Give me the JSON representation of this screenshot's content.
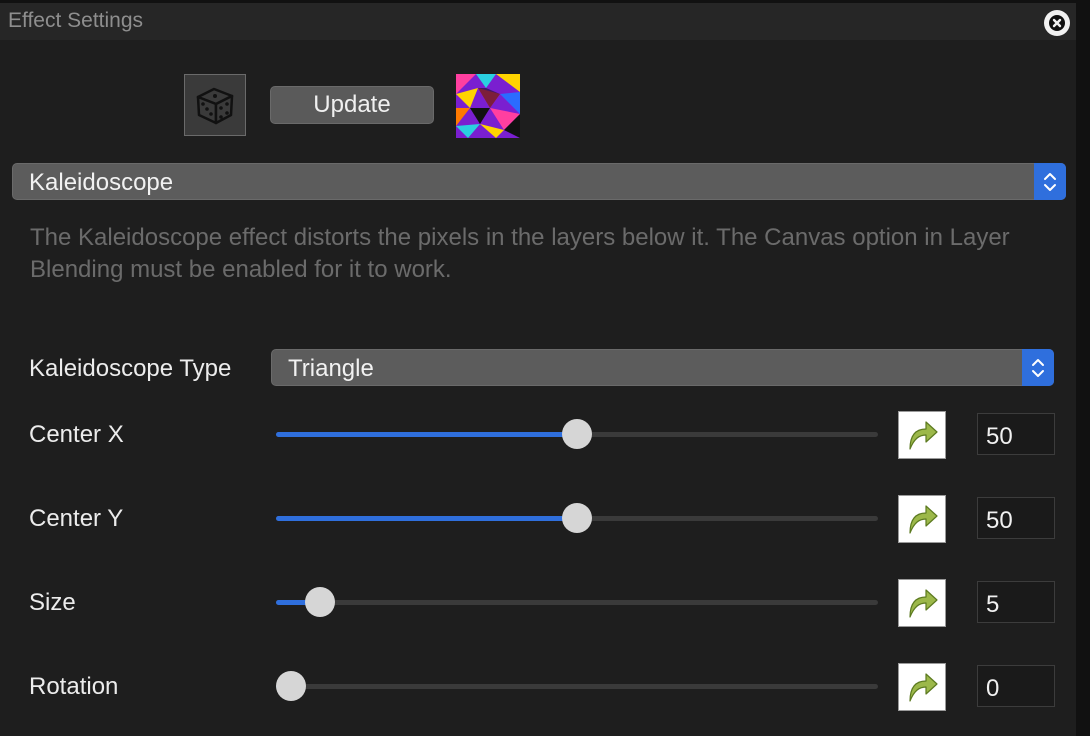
{
  "window": {
    "title": "Effect Settings"
  },
  "toolbar": {
    "update_label": "Update"
  },
  "effect_select": {
    "value": "Kaleidoscope"
  },
  "description": "The Kaleidoscope effect distorts the pixels in the layers below it. The Canvas option in Layer Blending must be enabled for it to work.",
  "type_row": {
    "label": "Kaleidoscope Type",
    "value": "Triangle"
  },
  "params": [
    {
      "label": "Center X",
      "value": "50",
      "fraction": 0.5
    },
    {
      "label": "Center Y",
      "value": "50",
      "fraction": 0.5
    },
    {
      "label": "Size",
      "value": "5",
      "fraction": 0.05
    },
    {
      "label": "Rotation",
      "value": "0",
      "fraction": 0.0
    }
  ],
  "icons": [
    "close-icon",
    "dice-icon",
    "preset-thumbnail",
    "chevron-updown-icon",
    "reset-arrow-icon"
  ],
  "colors": {
    "accent": "#2f6fdd",
    "background": "#1e1e1e",
    "reset_arrow": "#9cb84a"
  }
}
